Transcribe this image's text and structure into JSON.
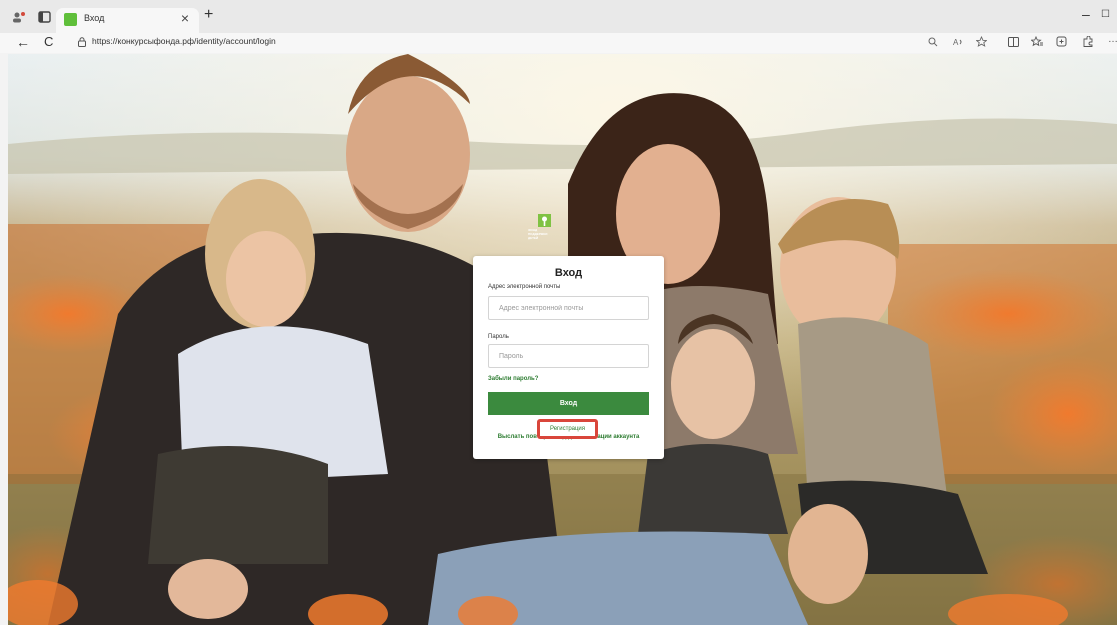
{
  "browser": {
    "tab_title": "Вход",
    "tab_close": "×",
    "new_tab": "+",
    "url": "https://конкурсыфонда.рф/identity/account/login",
    "back": "←",
    "reload": "C",
    "win_min": "–",
    "win_max": "☐",
    "right_icons": [
      "zoom-icon",
      "read-aloud-icon",
      "favorite-star-icon",
      "split-screen-icon",
      "favorites-icon",
      "collections-icon",
      "extensions-icon",
      "more-icon"
    ]
  },
  "logo": {
    "text_lines": [
      "ФОНД",
      "ПОДДЕРЖКИ",
      "ДЕТЕЙ"
    ]
  },
  "login": {
    "title": "Вход",
    "email_label": "Адрес электронной почты",
    "email_placeholder": "Адрес электронной почты",
    "password_label": "Пароль",
    "password_placeholder": "Пароль",
    "forgot": "Забыли пароль?",
    "submit": "Вход",
    "register": "Регистрация",
    "resend": "Выслать повторно код для активации аккаунта"
  },
  "colors": {
    "accent_green": "#3b8a3e",
    "highlight_red": "#d9463b"
  }
}
